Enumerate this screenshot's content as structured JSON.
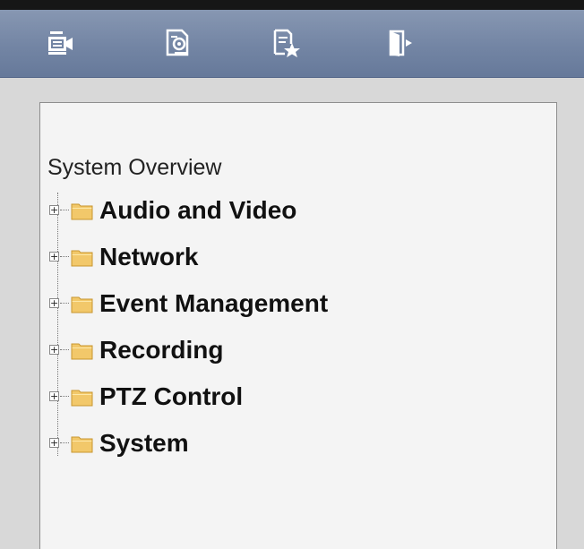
{
  "toolbar": {
    "buttons": [
      {
        "icon": "live-view-icon"
      },
      {
        "icon": "playback-icon"
      },
      {
        "icon": "log-icon"
      },
      {
        "icon": "logout-icon"
      }
    ]
  },
  "config_tree": {
    "root_label": "System Overview",
    "items": [
      {
        "label": "Audio and Video",
        "icon": "folder-icon",
        "expander": "+"
      },
      {
        "label": "Network",
        "icon": "folder-icon",
        "expander": "+"
      },
      {
        "label": "Event Management",
        "icon": "folder-icon",
        "expander": "+"
      },
      {
        "label": "Recording",
        "icon": "folder-icon",
        "expander": "+"
      },
      {
        "label": "PTZ Control",
        "icon": "folder-icon",
        "expander": "+"
      },
      {
        "label": "System",
        "icon": "folder-icon",
        "expander": "+"
      }
    ]
  },
  "colors": {
    "toolbar_bg": "#7385a4",
    "workarea_bg": "#d8d8d8",
    "panel_bg": "#f4f4f4",
    "folder": "#f2c86a"
  }
}
